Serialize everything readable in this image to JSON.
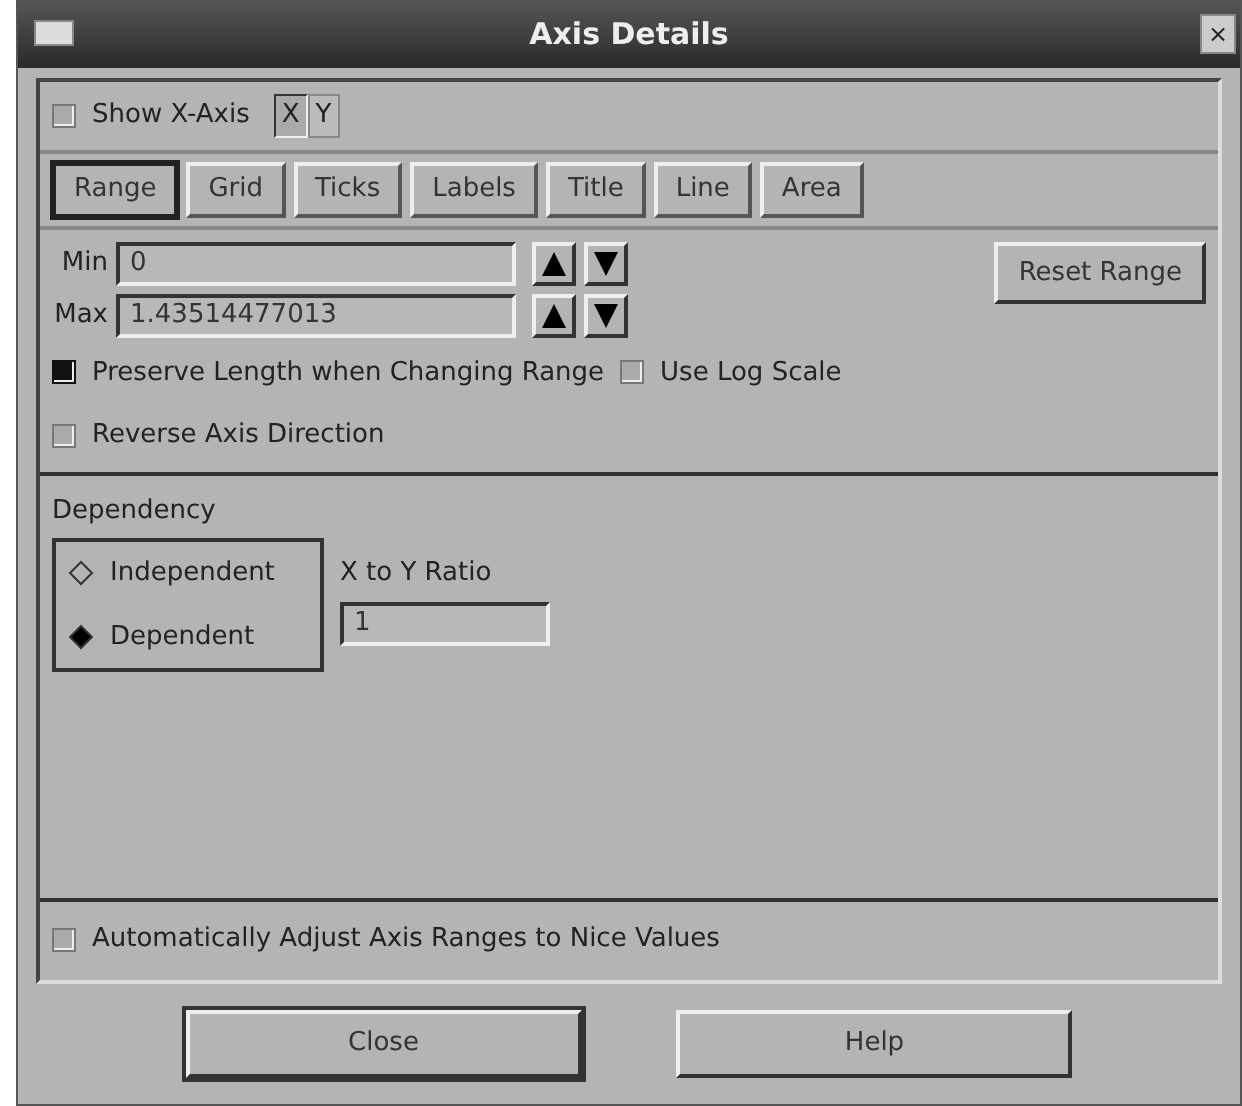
{
  "window": {
    "title": "Axis Details",
    "close": "×"
  },
  "show_axis": {
    "label": "Show X-Axis",
    "checked": false
  },
  "axis_toggle": [
    {
      "label": "X",
      "selected": true
    },
    {
      "label": "Y",
      "selected": false
    }
  ],
  "tabs": [
    {
      "label": "Range",
      "selected": true
    },
    {
      "label": "Grid",
      "selected": false
    },
    {
      "label": "Ticks",
      "selected": false
    },
    {
      "label": "Labels",
      "selected": false
    },
    {
      "label": "Title",
      "selected": false
    },
    {
      "label": "Line",
      "selected": false
    },
    {
      "label": "Area",
      "selected": false
    }
  ],
  "range_fields": [
    {
      "label": "Min",
      "value": "0"
    },
    {
      "label": "Max",
      "value": "1.43514477013"
    }
  ],
  "reset_button": "Reset Range",
  "options": [
    {
      "label": "Preserve Length when Changing Range",
      "checked": true
    },
    {
      "label": "Use Log Scale",
      "checked": false
    },
    {
      "label": "Reverse Axis Direction",
      "checked": false
    }
  ],
  "dependency": {
    "title": "Dependency",
    "radios": [
      {
        "label": "Independent",
        "selected": false
      },
      {
        "label": "Dependent",
        "selected": true
      }
    ],
    "ratio_label": "X to Y Ratio",
    "ratio_value": "1"
  },
  "auto_adjust": {
    "label": "Automatically Adjust Axis Ranges to Nice Values",
    "checked": false
  },
  "buttons": [
    "Close",
    "Help"
  ]
}
